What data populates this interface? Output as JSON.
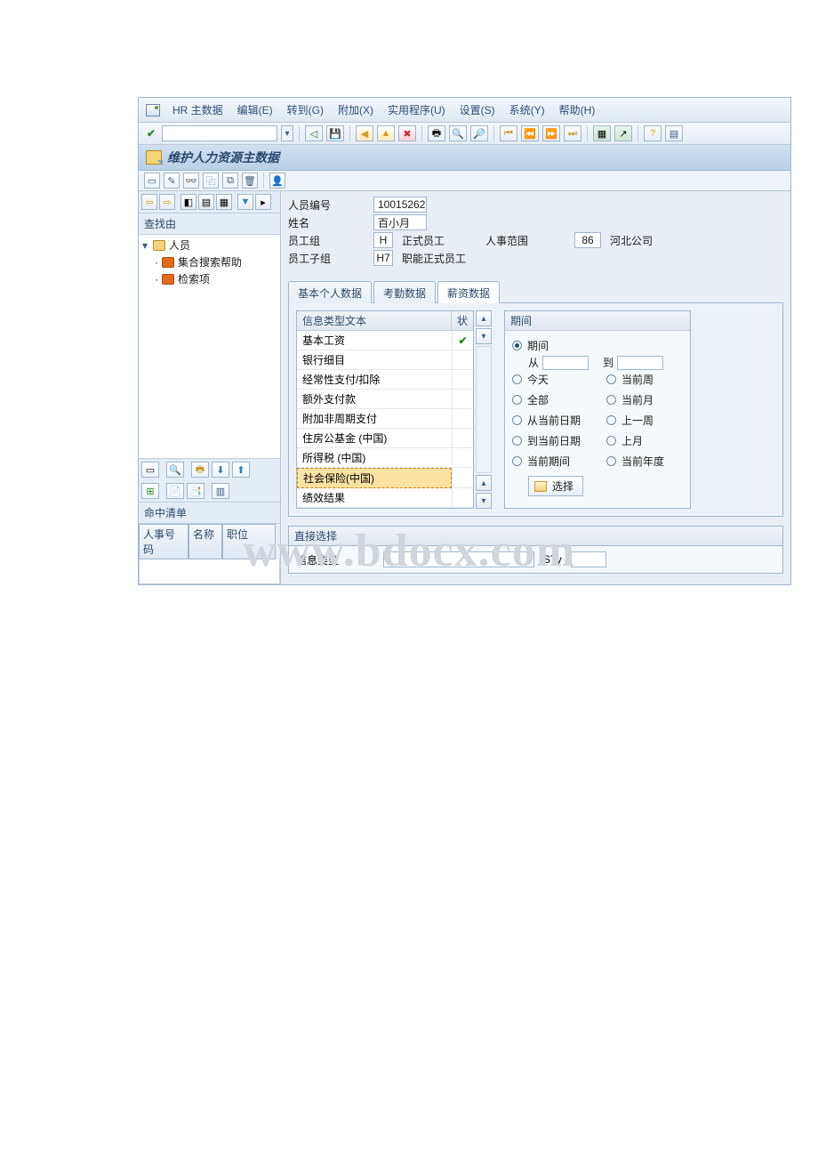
{
  "menubar": {
    "items": [
      "HR 主数据",
      "编辑(E)",
      "转到(G)",
      "附加(X)",
      "实用程序(U)",
      "设置(S)",
      "系统(Y)",
      "帮助(H)"
    ]
  },
  "title": "维护人力资源主数据",
  "left": {
    "find_label": "查找由",
    "tree": {
      "root": "人员",
      "child1": "集合搜索帮助",
      "child2": "检索项"
    },
    "hitlist_label": "命中清单",
    "hit_cols": [
      "人事号码",
      "名称",
      "职位"
    ]
  },
  "header_fields": {
    "pernr_label": "人员编号",
    "pernr": "10015262",
    "name_label": "姓名",
    "name": "百小月",
    "eg_label": "员工组",
    "eg_code": "H",
    "eg_text": "正式员工",
    "pa_label": "人事范围",
    "pa_code": "86",
    "pa_text": "河北公司",
    "esg_label": "员工子组",
    "esg_code": "H7",
    "esg_text": "职能正式员工"
  },
  "tabs": [
    "基本个人数据",
    "考勤数据",
    "薪资数据"
  ],
  "infotype": {
    "hdr_text": "信息类型文本",
    "hdr_status": "状",
    "rows": [
      {
        "text": "基本工资",
        "checked": true
      },
      {
        "text": "银行细目"
      },
      {
        "text": "经常性支付/扣除"
      },
      {
        "text": "额外支付款"
      },
      {
        "text": "附加非周期支付"
      },
      {
        "text": "住房公基金 (中国)"
      },
      {
        "text": "所得税 (中国)"
      },
      {
        "text": "社会保险(中国)",
        "selected": true
      },
      {
        "text": "绩效结果"
      }
    ]
  },
  "period": {
    "title": "期间",
    "opts": {
      "period": "期间",
      "from": "从",
      "to": "到",
      "today": "今天",
      "cur_week": "当前周",
      "all": "全部",
      "cur_month": "当前月",
      "from_cur": "从当前日期",
      "last_week": "上一周",
      "to_cur": "到当前日期",
      "last_month": "上月",
      "cur_period": "当前期间",
      "cur_year": "当前年度"
    },
    "select_btn": "选择"
  },
  "direct": {
    "title": "直接选择",
    "infotype_label": "信息类型",
    "sty_label": "STy"
  },
  "watermark": "www.bdocx.com"
}
